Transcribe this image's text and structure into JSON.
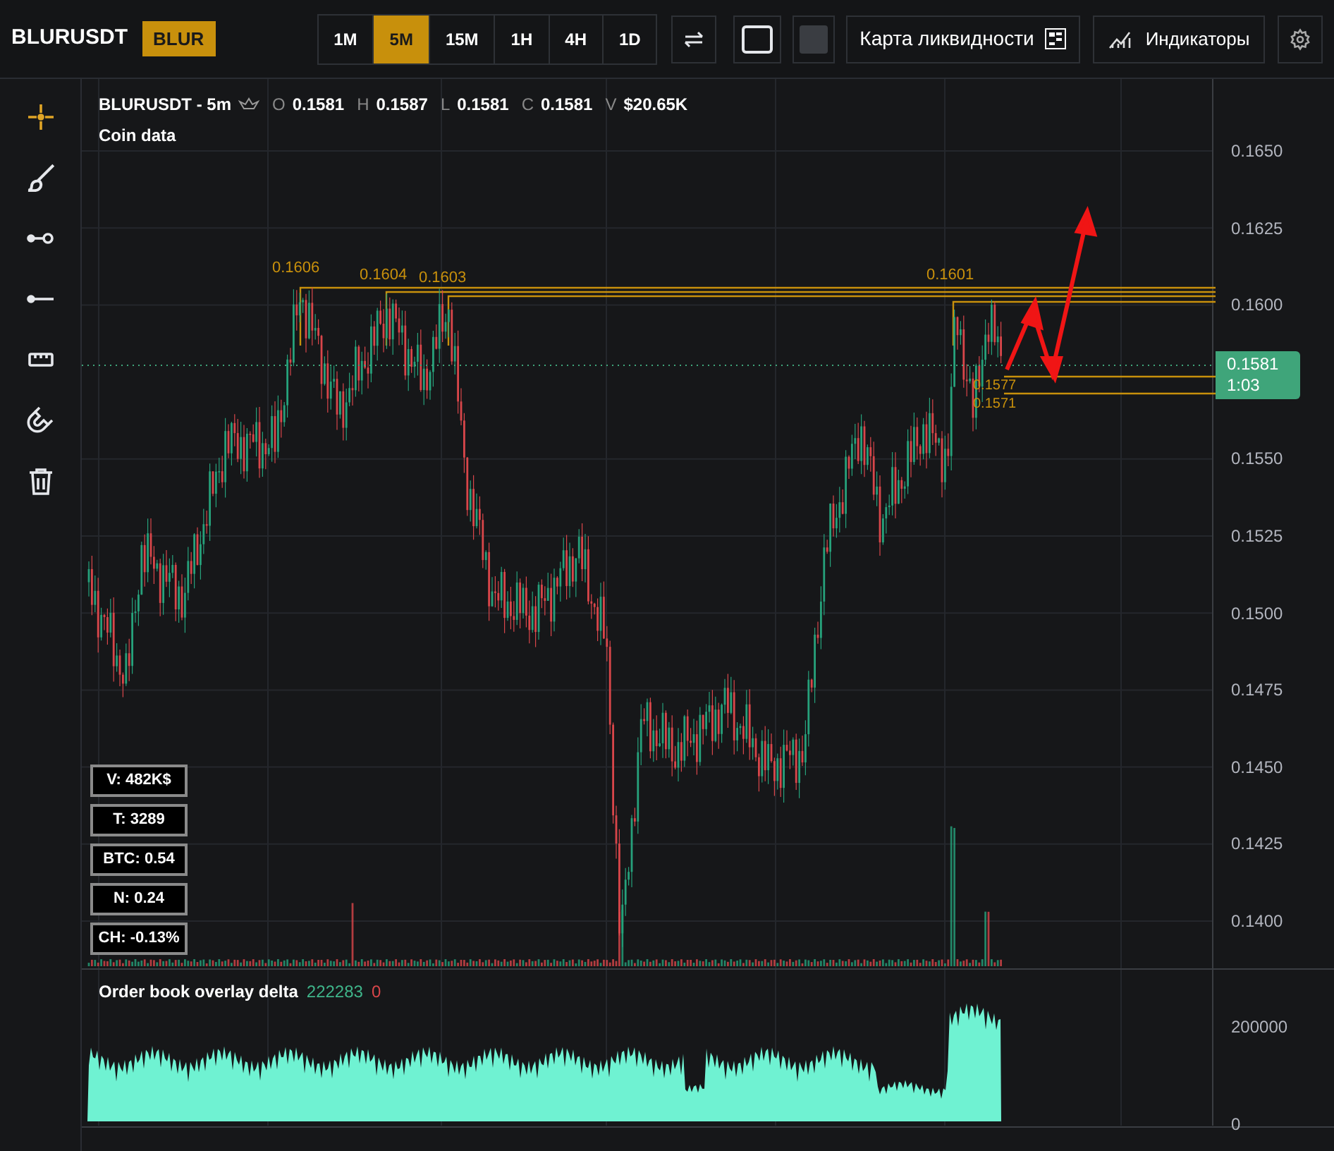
{
  "header": {
    "symbol": "BLURUSDT",
    "badge": "BLUR",
    "timeframes": [
      {
        "label": "1M",
        "selected": false
      },
      {
        "label": "5M",
        "selected": true
      },
      {
        "label": "15M",
        "selected": false
      },
      {
        "label": "1H",
        "selected": false
      },
      {
        "label": "4H",
        "selected": false
      },
      {
        "label": "1D",
        "selected": false
      }
    ],
    "liquidity_button": "Карта ликвидности",
    "indicators_button": "Индикаторы"
  },
  "tools": [
    {
      "kind": "crosshair",
      "selected": true
    },
    {
      "kind": "brush",
      "selected": false
    },
    {
      "kind": "ray",
      "selected": false
    },
    {
      "kind": "line",
      "selected": false
    },
    {
      "kind": "ruler",
      "selected": false
    },
    {
      "kind": "magnet",
      "selected": false
    },
    {
      "kind": "trash",
      "selected": false
    }
  ],
  "legend": {
    "title": "BLURUSDT - 5m",
    "fields": [
      {
        "label": "O",
        "value": "0.1581"
      },
      {
        "label": "H",
        "value": "0.1587"
      },
      {
        "label": "L",
        "value": "0.1581"
      },
      {
        "label": "C",
        "value": "0.1581"
      },
      {
        "label": "V",
        "value": "$20.65K"
      }
    ],
    "subtitle": "Coin data"
  },
  "stats": [
    "V: 482K$",
    "T: 3289",
    "BTC: 0.54",
    "N: 0.24",
    "CH: -0.13%"
  ],
  "levels": [
    "0.1606",
    "0.1604",
    "0.1603",
    "0.1601",
    "0.1577",
    "0.1571"
  ],
  "price_axis": [
    "0.1650",
    "0.1625",
    "0.1600",
    "0.1550",
    "0.1525",
    "0.1500",
    "0.1475",
    "0.1450",
    "0.1425",
    "0.1400"
  ],
  "last_price": {
    "value": "0.1581",
    "countdown": "1:03"
  },
  "indicator": {
    "name": "Order book overlay delta",
    "value_1": "222283",
    "value_2": "0",
    "axis": [
      "200000",
      "0"
    ]
  }
}
